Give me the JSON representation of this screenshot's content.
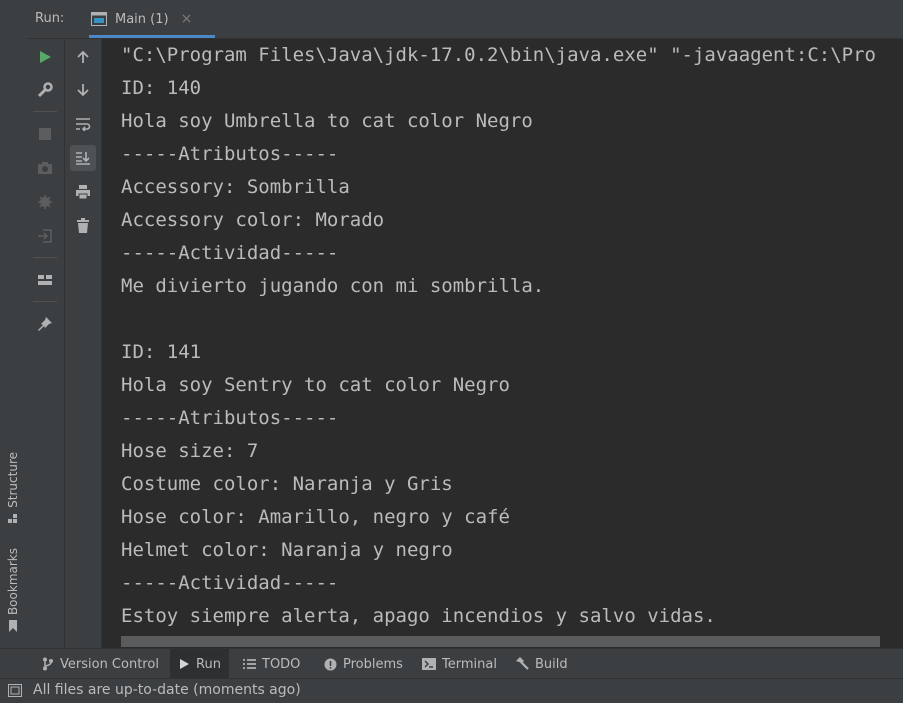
{
  "run_header": {
    "label": "Run:",
    "tab_label": "Main (1)",
    "tab_close": "×"
  },
  "left_strip": {
    "structure_label": "Structure",
    "bookmarks_label": "Bookmarks"
  },
  "console": {
    "lines": [
      "\"C:\\Program Files\\Java\\jdk-17.0.2\\bin\\java.exe\" \"-javaagent:C:\\Pro",
      "ID: 140",
      "Hola soy Umbrella to cat color Negro",
      "-----Atributos-----",
      "Accessory: Sombrilla",
      "Accessory color: Morado",
      "-----Actividad-----",
      "Me divierto jugando con mi sombrilla.",
      "",
      "ID: 141",
      "Hola soy Sentry to cat color Negro",
      "-----Atributos-----",
      "Hose size: 7",
      "Costume color: Naranja y Gris",
      "Hose color: Amarillo, negro y café",
      "Helmet color: Naranja y negro",
      "-----Actividad-----",
      "Estoy siempre alerta, apago incendios y salvo vidas."
    ]
  },
  "bottom_tabs": [
    {
      "label": "Version Control",
      "icon": "branch-icon"
    },
    {
      "label": "Run",
      "icon": "play-icon",
      "active": true
    },
    {
      "label": "TODO",
      "icon": "list-icon"
    },
    {
      "label": "Problems",
      "icon": "info-icon"
    },
    {
      "label": "Terminal",
      "icon": "terminal-icon"
    },
    {
      "label": "Build",
      "icon": "hammer-icon"
    }
  ],
  "status_bar": {
    "text": "All files are up-to-date (moments ago)"
  },
  "colors": {
    "background": "#2b2b2b",
    "panel": "#3c3f41",
    "text": "#bbbbbb",
    "accent": "#4a88c7",
    "run_green": "#59a869"
  }
}
